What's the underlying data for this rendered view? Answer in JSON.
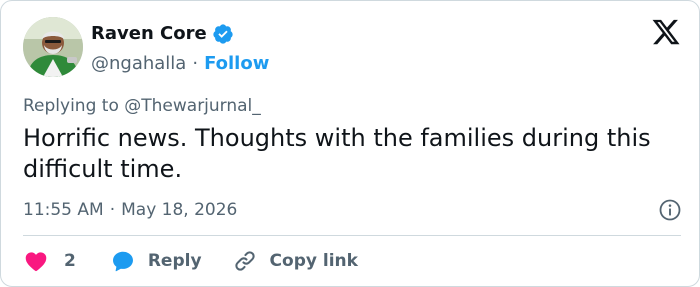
{
  "author": {
    "display_name": "Raven Core",
    "handle": "@ngahalla",
    "separator": "·",
    "follow_label": "Follow",
    "verified_color": "#1d9bf0"
  },
  "replying": {
    "prefix": "Replying to",
    "mention": "@Thewarjurnal_"
  },
  "tweet": {
    "text": "Horrific news. Thoughts with the families during this difficult time.",
    "time": "11:55 AM",
    "separator": "·",
    "date": "May 18, 2026"
  },
  "actions": {
    "like_count": "2",
    "like_color": "#f91880",
    "reply_label": "Reply",
    "reply_color": "#1d9bf0",
    "copy_label": "Copy link"
  },
  "icons": {
    "brand": "x-logo-icon",
    "verified": "verified-badge-icon",
    "info": "info-icon",
    "like": "heart-icon",
    "reply": "speech-bubble-icon",
    "copy": "link-icon"
  }
}
